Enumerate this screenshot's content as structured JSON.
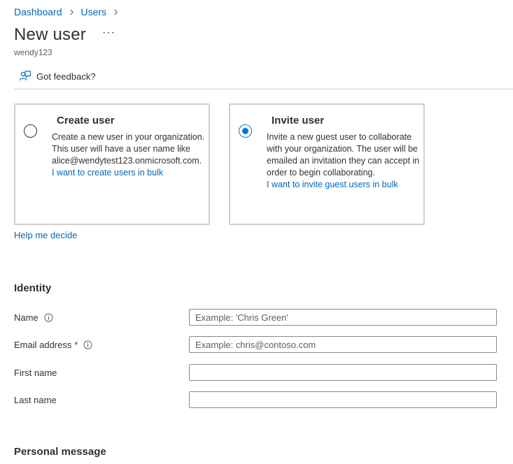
{
  "breadcrumb": [
    {
      "label": "Dashboard"
    },
    {
      "label": "Users"
    }
  ],
  "header": {
    "title": "New user",
    "more_label": "···",
    "subtitle": "wendy123"
  },
  "toolbar": {
    "feedback_label": "Got feedback?"
  },
  "options": {
    "create": {
      "title": "Create user",
      "description": "Create a new user in your organization. This user will have a user name like alice@wendytest123.onmicrosoft.com.",
      "link": "I want to create users in bulk",
      "selected": false
    },
    "invite": {
      "title": "Invite user",
      "description": "Invite a new guest user to collaborate with your organization. The user will be emailed an invitation they can accept in order to begin collaborating.",
      "link": "I want to invite guest users in bulk",
      "selected": true
    }
  },
  "help_link": "Help me decide",
  "identity": {
    "heading": "Identity",
    "fields": {
      "name": {
        "label": "Name",
        "placeholder": "Example: 'Chris Green'",
        "value": ""
      },
      "email": {
        "label": "Email address",
        "required_mark": "*",
        "placeholder": "Example: chris@contoso.com",
        "value": ""
      },
      "first_name": {
        "label": "First name",
        "placeholder": "",
        "value": ""
      },
      "last_name": {
        "label": "Last name",
        "placeholder": "",
        "value": ""
      }
    }
  },
  "personal_message": {
    "heading": "Personal message"
  },
  "colors": {
    "link": "#0067b8",
    "accent": "#0078d4",
    "required": "#a4262c",
    "border": "#d2d0ce"
  }
}
